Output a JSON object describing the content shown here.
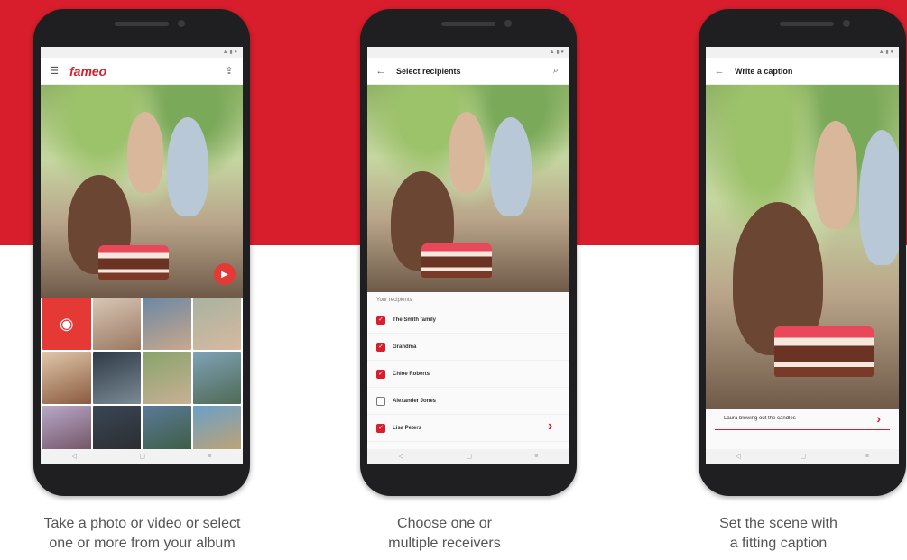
{
  "colors": {
    "brand_red": "#d81e2c",
    "accent_red": "#e53935",
    "phone_body": "#1f1f21"
  },
  "panels": [
    {
      "brand": "fameo",
      "description_line1": "Take a photo or video or select",
      "description_line2": "one or more from your album"
    },
    {
      "screen_title": "Select recipients",
      "recipients_heading": "Your recipients",
      "recipients": [
        {
          "name": "The Smith family",
          "checked": true
        },
        {
          "name": "Grandma",
          "checked": true
        },
        {
          "name": "Chloe Roberts",
          "checked": true
        },
        {
          "name": "Alexander Jones",
          "checked": false
        },
        {
          "name": "Lisa Peters",
          "checked": true
        }
      ],
      "description_line1": "Choose one or",
      "description_line2": "multiple receivers"
    },
    {
      "screen_title": "Write a caption",
      "caption_text": "Laura blowing out the candles",
      "description_line1": "Set the scene with",
      "description_line2": "a fitting caption"
    }
  ],
  "icons": {
    "menu": "hamburger-menu-icon",
    "upload": "upload-icon",
    "back": "back-arrow-icon",
    "search": "search-icon",
    "camera": "camera-icon",
    "next": "chevron-right-icon",
    "play": "play-icon"
  }
}
